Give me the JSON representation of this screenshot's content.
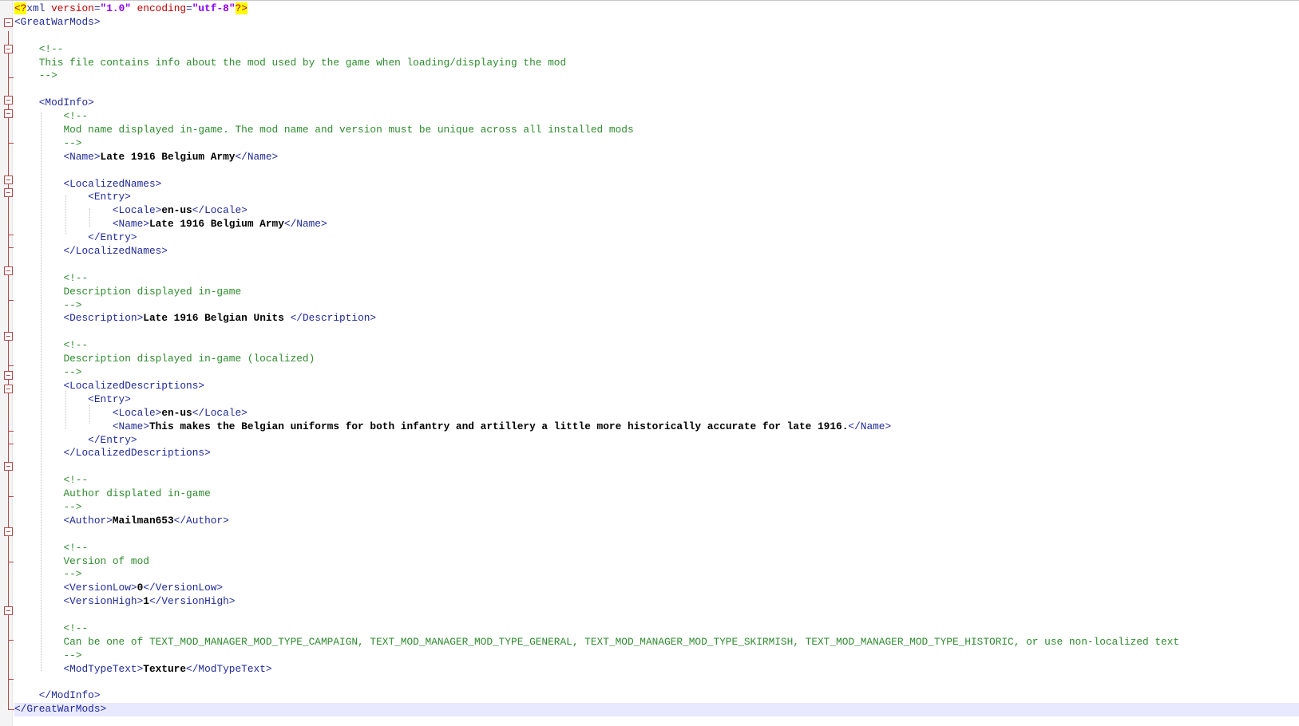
{
  "lines": [
    {
      "indent": "",
      "segments": [
        {
          "t": "pi",
          "v": "<?"
        },
        {
          "t": "tag",
          "v": "xml "
        },
        {
          "t": "attr",
          "v": "version"
        },
        {
          "t": "tag",
          "v": "="
        },
        {
          "t": "value",
          "v": "\"1.0\""
        },
        {
          "t": "tag",
          "v": " "
        },
        {
          "t": "attr",
          "v": "encoding"
        },
        {
          "t": "tag",
          "v": "="
        },
        {
          "t": "value",
          "v": "\"utf-8\""
        },
        {
          "t": "pi",
          "v": "?>"
        }
      ]
    },
    {
      "indent": "",
      "segments": [
        {
          "t": "tag",
          "v": "<GreatWarMods>"
        }
      ]
    },
    {
      "indent": "",
      "segments": []
    },
    {
      "indent": "    ",
      "segments": [
        {
          "t": "comment",
          "v": "<!--"
        }
      ]
    },
    {
      "indent": "    ",
      "segments": [
        {
          "t": "comment",
          "v": "This file contains info about the mod used by the game when loading/displaying the mod"
        }
      ]
    },
    {
      "indent": "    ",
      "segments": [
        {
          "t": "comment",
          "v": "-->"
        }
      ]
    },
    {
      "indent": "",
      "segments": []
    },
    {
      "indent": "    ",
      "segments": [
        {
          "t": "tag",
          "v": "<ModInfo>"
        }
      ]
    },
    {
      "indent": "        ",
      "segments": [
        {
          "t": "comment",
          "v": "<!--"
        }
      ]
    },
    {
      "indent": "        ",
      "segments": [
        {
          "t": "comment",
          "v": "Mod name displayed in-game. The mod name and version must be unique across all installed mods"
        }
      ]
    },
    {
      "indent": "        ",
      "segments": [
        {
          "t": "comment",
          "v": "-->"
        }
      ]
    },
    {
      "indent": "        ",
      "segments": [
        {
          "t": "tag",
          "v": "<Name>"
        },
        {
          "t": "text",
          "v": "Late 1916 Belgium Army"
        },
        {
          "t": "tag",
          "v": "</Name>"
        }
      ]
    },
    {
      "indent": "",
      "segments": []
    },
    {
      "indent": "        ",
      "segments": [
        {
          "t": "tag",
          "v": "<LocalizedNames>"
        }
      ]
    },
    {
      "indent": "            ",
      "segments": [
        {
          "t": "tag",
          "v": "<Entry>"
        }
      ]
    },
    {
      "indent": "                ",
      "segments": [
        {
          "t": "tag",
          "v": "<Locale>"
        },
        {
          "t": "text",
          "v": "en-us"
        },
        {
          "t": "tag",
          "v": "</Locale>"
        }
      ]
    },
    {
      "indent": "                ",
      "segments": [
        {
          "t": "tag",
          "v": "<Name>"
        },
        {
          "t": "text",
          "v": "Late 1916 Belgium Army"
        },
        {
          "t": "tag",
          "v": "</Name>"
        }
      ]
    },
    {
      "indent": "            ",
      "segments": [
        {
          "t": "tag",
          "v": "</Entry>"
        }
      ]
    },
    {
      "indent": "        ",
      "segments": [
        {
          "t": "tag",
          "v": "</LocalizedNames>"
        }
      ]
    },
    {
      "indent": "",
      "segments": []
    },
    {
      "indent": "        ",
      "segments": [
        {
          "t": "comment",
          "v": "<!--"
        }
      ]
    },
    {
      "indent": "        ",
      "segments": [
        {
          "t": "comment",
          "v": "Description displayed in-game"
        }
      ]
    },
    {
      "indent": "        ",
      "segments": [
        {
          "t": "comment",
          "v": "-->"
        }
      ]
    },
    {
      "indent": "        ",
      "segments": [
        {
          "t": "tag",
          "v": "<Description>"
        },
        {
          "t": "text",
          "v": "Late 1916 Belgian Units "
        },
        {
          "t": "tag",
          "v": "</Description>"
        }
      ]
    },
    {
      "indent": "",
      "segments": []
    },
    {
      "indent": "        ",
      "segments": [
        {
          "t": "comment",
          "v": "<!--"
        }
      ]
    },
    {
      "indent": "        ",
      "segments": [
        {
          "t": "comment",
          "v": "Description displayed in-game (localized)"
        }
      ]
    },
    {
      "indent": "        ",
      "segments": [
        {
          "t": "comment",
          "v": "-->"
        }
      ]
    },
    {
      "indent": "        ",
      "segments": [
        {
          "t": "tag",
          "v": "<LocalizedDescriptions>"
        }
      ]
    },
    {
      "indent": "            ",
      "segments": [
        {
          "t": "tag",
          "v": "<Entry>"
        }
      ]
    },
    {
      "indent": "                ",
      "segments": [
        {
          "t": "tag",
          "v": "<Locale>"
        },
        {
          "t": "text",
          "v": "en-us"
        },
        {
          "t": "tag",
          "v": "</Locale>"
        }
      ]
    },
    {
      "indent": "                ",
      "segments": [
        {
          "t": "tag",
          "v": "<Name>"
        },
        {
          "t": "text",
          "v": "This makes the Belgian uniforms for both infantry and artillery a little more historically accurate for late 1916."
        },
        {
          "t": "tag",
          "v": "</Name>"
        }
      ]
    },
    {
      "indent": "            ",
      "segments": [
        {
          "t": "tag",
          "v": "</Entry>"
        }
      ]
    },
    {
      "indent": "        ",
      "segments": [
        {
          "t": "tag",
          "v": "</LocalizedDescriptions>"
        }
      ]
    },
    {
      "indent": "",
      "segments": []
    },
    {
      "indent": "        ",
      "segments": [
        {
          "t": "comment",
          "v": "<!--"
        }
      ]
    },
    {
      "indent": "        ",
      "segments": [
        {
          "t": "comment",
          "v": "Author displated in-game"
        }
      ]
    },
    {
      "indent": "        ",
      "segments": [
        {
          "t": "comment",
          "v": "-->"
        }
      ]
    },
    {
      "indent": "        ",
      "segments": [
        {
          "t": "tag",
          "v": "<Author>"
        },
        {
          "t": "text",
          "v": "Mailman653"
        },
        {
          "t": "tag",
          "v": "</Author>"
        }
      ]
    },
    {
      "indent": "",
      "segments": []
    },
    {
      "indent": "        ",
      "segments": [
        {
          "t": "comment",
          "v": "<!--"
        }
      ]
    },
    {
      "indent": "        ",
      "segments": [
        {
          "t": "comment",
          "v": "Version of mod"
        }
      ]
    },
    {
      "indent": "        ",
      "segments": [
        {
          "t": "comment",
          "v": "-->"
        }
      ]
    },
    {
      "indent": "        ",
      "segments": [
        {
          "t": "tag",
          "v": "<VersionLow>"
        },
        {
          "t": "text",
          "v": "0"
        },
        {
          "t": "tag",
          "v": "</VersionLow>"
        }
      ]
    },
    {
      "indent": "        ",
      "segments": [
        {
          "t": "tag",
          "v": "<VersionHigh>"
        },
        {
          "t": "text",
          "v": "1"
        },
        {
          "t": "tag",
          "v": "</VersionHigh>"
        }
      ]
    },
    {
      "indent": "",
      "segments": []
    },
    {
      "indent": "        ",
      "segments": [
        {
          "t": "comment",
          "v": "<!--"
        }
      ]
    },
    {
      "indent": "        ",
      "segments": [
        {
          "t": "comment",
          "v": "Can be one of TEXT_MOD_MANAGER_MOD_TYPE_CAMPAIGN, TEXT_MOD_MANAGER_MOD_TYPE_GENERAL, TEXT_MOD_MANAGER_MOD_TYPE_SKIRMISH, TEXT_MOD_MANAGER_MOD_TYPE_HISTORIC, or use non-localized text"
        }
      ]
    },
    {
      "indent": "        ",
      "segments": [
        {
          "t": "comment",
          "v": "-->"
        }
      ]
    },
    {
      "indent": "        ",
      "segments": [
        {
          "t": "tag",
          "v": "<ModTypeText>"
        },
        {
          "t": "text",
          "v": "Texture"
        },
        {
          "t": "tag",
          "v": "</ModTypeText>"
        }
      ]
    },
    {
      "indent": "",
      "segments": []
    },
    {
      "indent": "    ",
      "segments": [
        {
          "t": "tag",
          "v": "</ModInfo>"
        }
      ]
    },
    {
      "indent": "",
      "current": true,
      "segments": [
        {
          "t": "tag",
          "v": "</GreatWarMods>"
        }
      ]
    }
  ]
}
